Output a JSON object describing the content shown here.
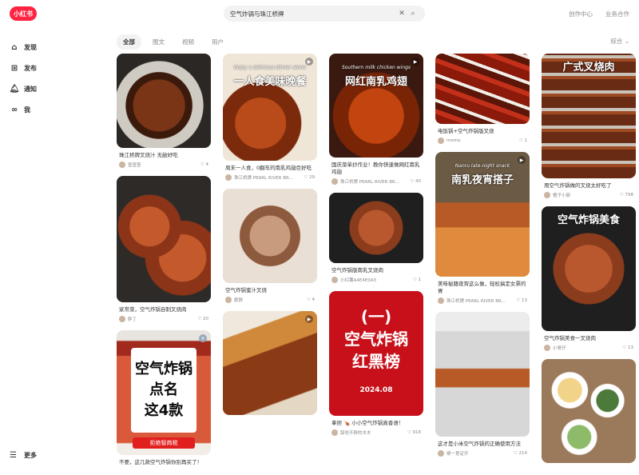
{
  "app": {
    "logo": "小红书"
  },
  "search": {
    "value": "空气炸锅与珠江桥牌",
    "clear_icon": "close-icon",
    "search_icon": "search-icon"
  },
  "header": {
    "links": [
      "创作中心",
      "业务合作"
    ]
  },
  "sidebar": {
    "items": [
      {
        "label": "发现",
        "icon": "home-icon"
      },
      {
        "label": "发布",
        "icon": "plus-square-icon"
      },
      {
        "label": "通知",
        "icon": "bell-icon"
      },
      {
        "label": "我",
        "icon": "user-avatar-icon"
      }
    ],
    "more": "更多"
  },
  "tabs": [
    "全部",
    "图文",
    "视频",
    "用户"
  ],
  "sort": "综合 ⌄",
  "columns": [
    [
      {
        "title": "珠江桥牌叉烧汁 无敌好吃",
        "author": "壹壹壹",
        "likes": "4",
        "overlay": "",
        "video": false,
        "h": 118,
        "bg": "bg-ribs"
      },
      {
        "title": "家常菜，空气炸锅自制叉烧肉",
        "author": "胖丁",
        "likes": "20",
        "overlay": "",
        "video": false,
        "h": 158,
        "bg": "bg-steak"
      },
      {
        "title": "不要，这几款空气炸锅你别再买了！",
        "author": "",
        "likes": "",
        "overlay": "",
        "video": false,
        "h": 156,
        "bg": "bg-airfryer-red",
        "poster_lines": [
          "空气炸锅",
          "点名",
          "这4款"
        ],
        "poster_badge": "拒绝智商税"
      }
    ],
    [
      {
        "title": "周末一人食，0翻车的南乳鸡翅巨好吃",
        "author": "珠江桥牌 PEARL RIVER BR...",
        "likes": "29",
        "overlay": "一人食美味晚餐",
        "overlay_sub": "Enjoy a delicious dinner alone",
        "video": true,
        "h": 134,
        "bg": "bg-wings1"
      },
      {
        "title": "空气炸锅蜜汁叉烧",
        "author": "鄭鄭",
        "likes": "4",
        "overlay": "",
        "video": false,
        "h": 118,
        "bg": "bg-belly"
      },
      {
        "title": "",
        "author": "",
        "likes": "",
        "overlay": "",
        "video": true,
        "h": 130,
        "bg": "bg-wings3"
      }
    ],
    [
      {
        "title": "国庆菜单抄作业！教你快速做网红南乳鸡翅",
        "author": "珠江桥牌 PEARL RIVER BR...",
        "likes": "40",
        "overlay": "网红南乳鸡翅",
        "overlay_sub": "Southern milk chicken wings",
        "video": true,
        "h": 130,
        "bg": "bg-wings2"
      },
      {
        "title": "空气炸锅版南乳叉烧肉",
        "author": "小红薯A4E4E0A3",
        "likes": "1",
        "overlay": "",
        "video": false,
        "h": 88,
        "bg": "bg-roast"
      },
      {
        "title": "拿捏 🍗 小小空气炸锅真香语！",
        "author": "踩吃不胖的木木",
        "likes": "918",
        "overlay": "",
        "video": false,
        "h": 156,
        "bg": "bg-red-poster",
        "poster_lines": [
          "(一)",
          "空气炸锅",
          "红黑榜"
        ],
        "poster_year": "2024.08"
      }
    ],
    [
      {
        "title": "电饭锅+空气炸锅版叉烧",
        "author": "momo",
        "likes": "1",
        "overlay": "",
        "video": false,
        "h": 88,
        "bg": "bg-char1"
      },
      {
        "title": "美味秘籍夜宵这么做，轻松搞定女票的胃",
        "author": "珠江桥牌 PEARL RIVER BR...",
        "likes": "13",
        "overlay": "南乳夜宵搭子",
        "overlay_sub": "Nanru late-night snack",
        "video": true,
        "h": 156,
        "bg": "bg-skewers"
      },
      {
        "title": "这才是小米空气炸锅的正确使用方法",
        "author": "柳一意定开",
        "likes": "214",
        "overlay": "",
        "video": false,
        "h": 156,
        "bg": "bg-device"
      }
    ],
    [
      {
        "title": "用空气炸锅做的叉烧太好吃了",
        "author": "橙子小厨",
        "likes": "798",
        "overlay": "广式叉烧肉",
        "overlay_sub": "",
        "video": false,
        "h": 156,
        "bg": "bg-ribs2"
      },
      {
        "title": "空气炸锅美食一叉烧肉",
        "author": "小哥仔",
        "likes": "13",
        "overlay": "空气炸锅美食",
        "overlay_sub": "",
        "video": false,
        "h": 156,
        "bg": "bg-roast"
      },
      {
        "title": "",
        "author": "",
        "likes": "",
        "overlay": "",
        "video": false,
        "h": 130,
        "bg": "bg-dishes"
      }
    ]
  ]
}
